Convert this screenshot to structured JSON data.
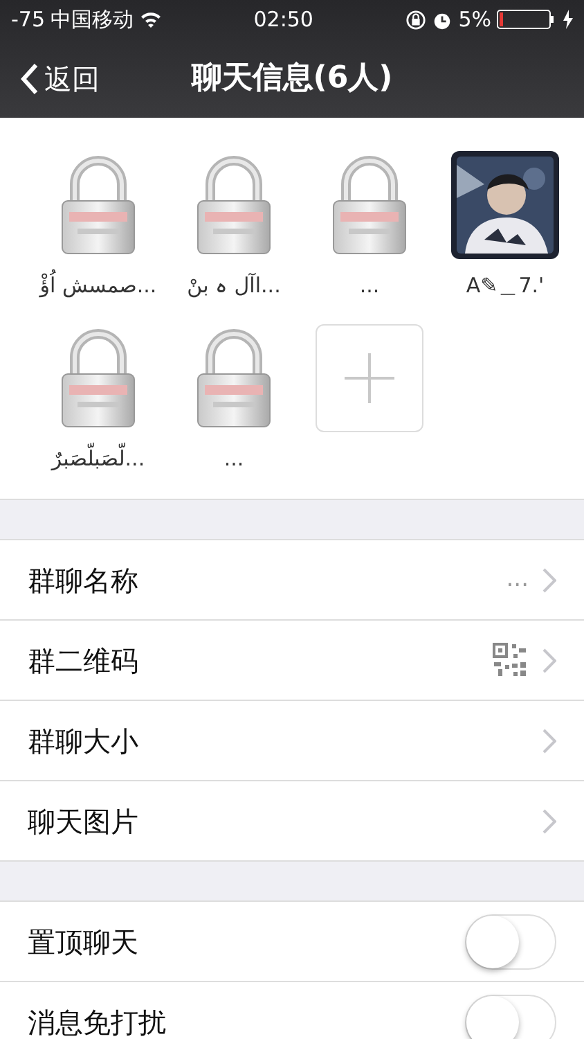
{
  "status_bar": {
    "signal": "-75",
    "carrier": "中国移动",
    "time": "02:50",
    "battery": "5%"
  },
  "nav": {
    "back": "返回",
    "title": "聊天信息(6人)"
  },
  "members": [
    {
      "kind": "lock",
      "name": "صمسش اُؤْ..."
    },
    {
      "kind": "lock",
      "name": "اآل ہ بنْ..."
    },
    {
      "kind": "lock",
      "name": "..."
    },
    {
      "name": "A✎＿7.'"
    },
    {
      "kind": "lock",
      "name": "لّصَبلّصَبرٌ..."
    },
    {
      "kind": "lock",
      "name": "..."
    },
    {
      "kind": "add"
    }
  ],
  "settings": [
    {
      "label": "群聊名称",
      "kind": "text",
      "value": "..."
    },
    {
      "label": "群二维码",
      "kind": "qr"
    },
    {
      "label": "群聊大小",
      "kind": "plain"
    },
    {
      "label": "聊天图片",
      "kind": "plain"
    }
  ],
  "toggles": [
    {
      "label": "置顶聊天",
      "on": false
    },
    {
      "label": "消息免打扰",
      "on": false
    }
  ]
}
